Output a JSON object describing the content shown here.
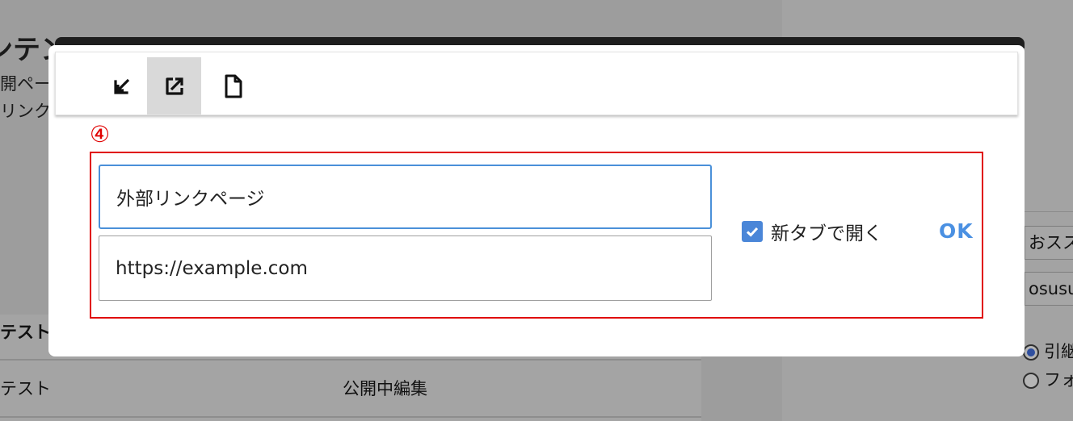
{
  "background": {
    "title": "ンテン",
    "line1": "開ペー",
    "line2": "リンク",
    "table_header": "テスト",
    "row_name": "テスト",
    "row_status": "公開中編集",
    "right_input_1": "おスス",
    "right_input_2": "osusu",
    "radio_1": "引継",
    "radio_2": "フォ"
  },
  "toolbar": {
    "buttons": [
      {
        "icon": "import-icon",
        "active": false
      },
      {
        "icon": "external-link-icon",
        "active": true
      },
      {
        "icon": "page-icon",
        "active": false
      }
    ]
  },
  "step_marker": "④",
  "link_form": {
    "title_value": "外部リンクページ",
    "url_value": "https://example.com",
    "new_tab_label": "新タブで開く",
    "new_tab_checked": true,
    "ok_label": "OK"
  },
  "colors": {
    "accent": "#4a90e2",
    "highlight_border": "#e00000",
    "checkbox": "#4a86d8"
  }
}
